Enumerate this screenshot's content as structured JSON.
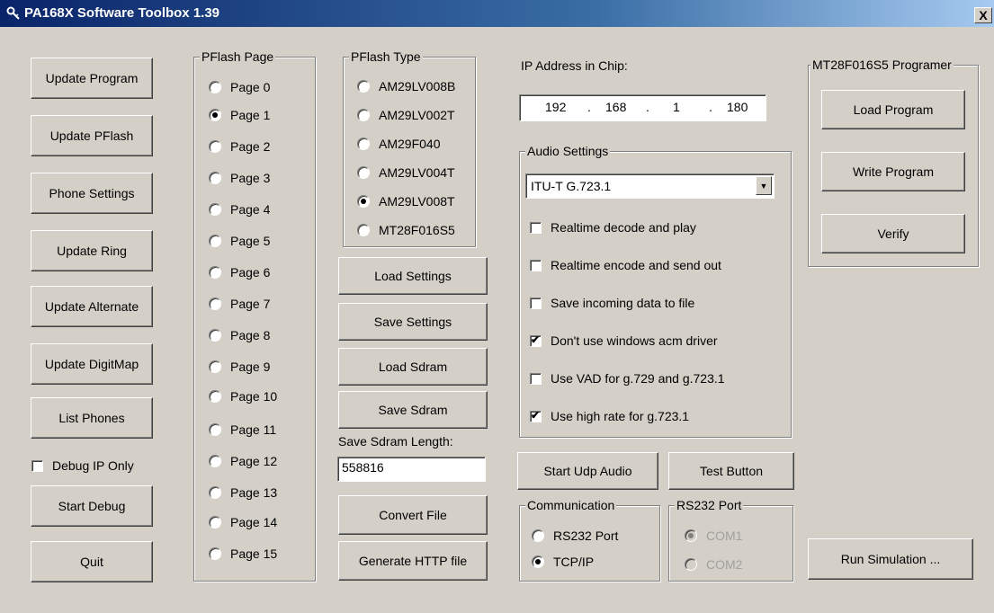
{
  "window": {
    "title": "PA168X Software Toolbox 1.39",
    "close_label": "X"
  },
  "left_buttons": {
    "update_program": "Update Program",
    "update_pflash": "Update PFlash",
    "phone_settings": "Phone Settings",
    "update_ring": "Update Ring",
    "update_alternate": "Update Alternate",
    "update_digitmap": "Update DigitMap",
    "list_phones": "List Phones",
    "debug_ip_only": "Debug IP Only",
    "start_debug": "Start Debug",
    "quit": "Quit"
  },
  "debug_ip_only_checked": false,
  "pflash_page": {
    "legend": "PFlash Page",
    "options": [
      "Page 0",
      "Page 1",
      "Page 2",
      "Page 3",
      "Page 4",
      "Page 5",
      "Page 6",
      "Page 7",
      "Page 8",
      "Page 9",
      "Page 10",
      "Page 11",
      "Page 12",
      "Page 13",
      "Page 14",
      "Page 15"
    ],
    "selected": "Page 1"
  },
  "pflash_type": {
    "legend": "PFlash Type",
    "options": [
      "AM29LV008B",
      "AM29LV002T",
      "AM29F040",
      "AM29LV004T",
      "AM29LV008T",
      "MT28F016S5"
    ],
    "selected": "AM29LV008T"
  },
  "middle_buttons": {
    "load_settings": "Load Settings",
    "save_settings": "Save Settings",
    "load_sdram": "Load Sdram",
    "save_sdram": "Save Sdram",
    "convert_file": "Convert File",
    "generate_http": "Generate HTTP file"
  },
  "sdram_length": {
    "label": "Save Sdram Length:",
    "value": "558816"
  },
  "ip": {
    "label": "IP Address in Chip:",
    "octets": [
      "192",
      "168",
      "1",
      "180"
    ],
    "separator": "."
  },
  "audio": {
    "legend": "Audio Settings",
    "codec": "ITU-T G.723.1",
    "options": [
      {
        "label": "Realtime decode and play",
        "checked": false
      },
      {
        "label": "Realtime encode and send out",
        "checked": false
      },
      {
        "label": "Save incoming data to file",
        "checked": false
      },
      {
        "label": "Don't use windows acm driver",
        "checked": true
      },
      {
        "label": "Use VAD for g.729 and g.723.1",
        "checked": false
      },
      {
        "label": "Use high rate for g.723.1",
        "checked": true
      }
    ]
  },
  "start_udp_audio": "Start Udp Audio",
  "test_button": "Test Button",
  "communication": {
    "legend": "Communication",
    "options": [
      "RS232 Port",
      "TCP/IP"
    ],
    "selected": "TCP/IP"
  },
  "rs232_port": {
    "legend": "RS232 Port",
    "options": [
      "COM1",
      "COM2"
    ],
    "selected": "COM1",
    "disabled": true
  },
  "mt28": {
    "legend": "MT28F016S5 Programer",
    "load_program": "Load Program",
    "write_program": "Write Program",
    "verify": "Verify"
  },
  "run_simulation": "Run Simulation ..."
}
